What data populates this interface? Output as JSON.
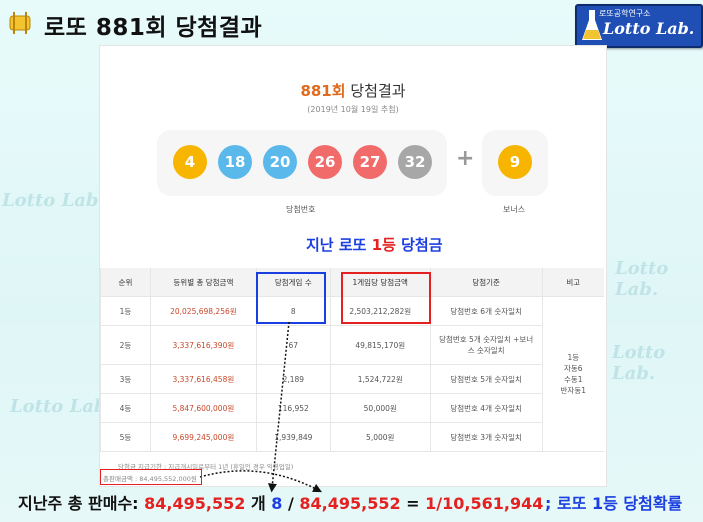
{
  "header": {
    "title": "로또 881회 당첨결과"
  },
  "logo": {
    "top_text": "로또공학연구소",
    "main_text": "Lotto Lab."
  },
  "watermark_text": "Lotto Lab.",
  "result": {
    "round": "881회",
    "title_suffix": "당첨결과",
    "date": "(2019년 10월 19일 추첨)",
    "numbers": [
      "4",
      "18",
      "20",
      "26",
      "27",
      "32"
    ],
    "bonus": "9",
    "numbers_caption": "당첨번호",
    "bonus_caption": "보너스"
  },
  "colors": {
    "yellow": "#f7b500",
    "blue": "#5ab9ea",
    "red": "#f26b6b",
    "gray": "#a7a7a7"
  },
  "subtitle": {
    "pre": "지난 로또 ",
    "highlight": "1등",
    "post": " 당첨금"
  },
  "table": {
    "headers": [
      "순위",
      "등위별 총 당첨금액",
      "당첨게임 수",
      "1게임당 당첨금액",
      "당첨기준",
      "비고"
    ],
    "rows": [
      [
        "1등",
        "20,025,698,256원",
        "8",
        "2,503,212,282원",
        "당첨번호 6개 숫자일치"
      ],
      [
        "2등",
        "3,337,616,390원",
        "67",
        "49,815,170원",
        "당첨번호 5개 숫자일치 +보너스 숫자일치"
      ],
      [
        "3등",
        "3,337,616,458원",
        "2,189",
        "1,524,722원",
        "당첨번호 5개 숫자일치"
      ],
      [
        "4등",
        "5,847,600,000원",
        "116,952",
        "50,000원",
        "당첨번호 4개 숫자일치"
      ],
      [
        "5등",
        "9,699,245,000원",
        "1,939,849",
        "5,000원",
        "당첨번호 3개 숫자일치"
      ]
    ],
    "remark": [
      "1등",
      "자동6",
      "수동1",
      "반자동1"
    ]
  },
  "footnote": "당첨금 지급기한 : 지급개시일로부터 1년 (휴일인 경우 익영업일)",
  "total_sales": "총판매금액 : 84,495,552,000원",
  "bottom": {
    "label": "지난주 총 판매수: ",
    "sales": "84,495,552",
    "unit": " 개  ",
    "winners": "8",
    "slash": " / ",
    "sales2": "84,495,552",
    "eq": " = ",
    "odds": "1/10,561,944",
    "right": "; 로또 1등 당첨확률"
  }
}
